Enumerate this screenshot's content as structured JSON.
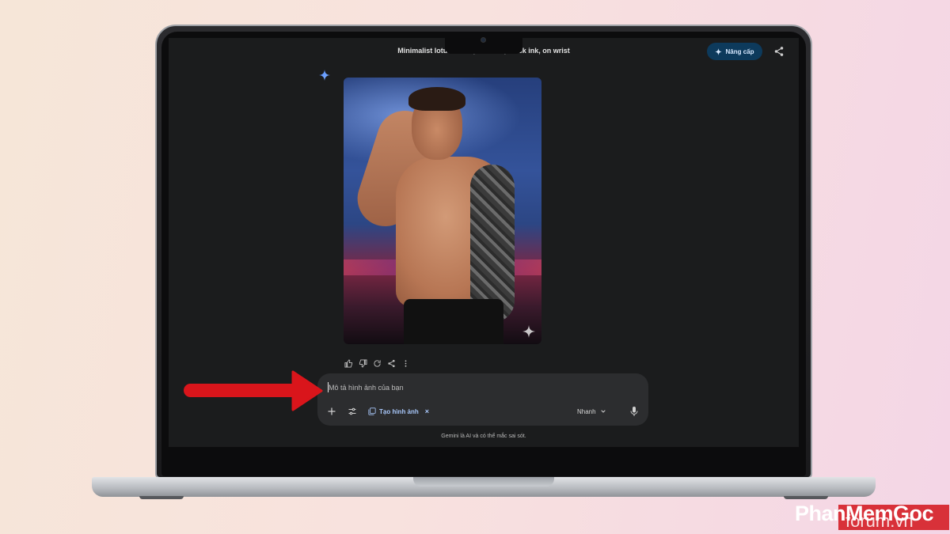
{
  "conversation": {
    "title": "Minimalist lotus tattoo, fine line, black ink, on wrist"
  },
  "header": {
    "upgrade_label": "Nâng cấp",
    "upgrade_icon": "sparkle-icon",
    "share_icon": "share-icon"
  },
  "response": {
    "icon": "gemini-sparkle-icon",
    "image_badge_icon": "gemini-sparkle-icon",
    "actions": [
      "thumb-up-icon",
      "thumb-down-icon",
      "refresh-icon",
      "share-icon",
      "more-vert-icon"
    ]
  },
  "composer": {
    "placeholder": "Mô tả hình ảnh của bạn",
    "add_icon": "plus-icon",
    "tools_icon": "tune-icon",
    "chip_label": "Tạo hình ảnh",
    "chip_close": "×",
    "model_label": "Nhanh",
    "mic_icon": "mic-icon"
  },
  "footer": {
    "disclaimer": "Gemini là AI và có thể mắc sai sót."
  },
  "watermark": {
    "brand": "PhanMemGoc",
    "suffix": "forum.vn"
  },
  "colors": {
    "screen_bg": "#1b1c1d",
    "accent": "#a8c7fa",
    "upgrade_bg": "#0d3a5c",
    "arrow": "#d9151b"
  }
}
